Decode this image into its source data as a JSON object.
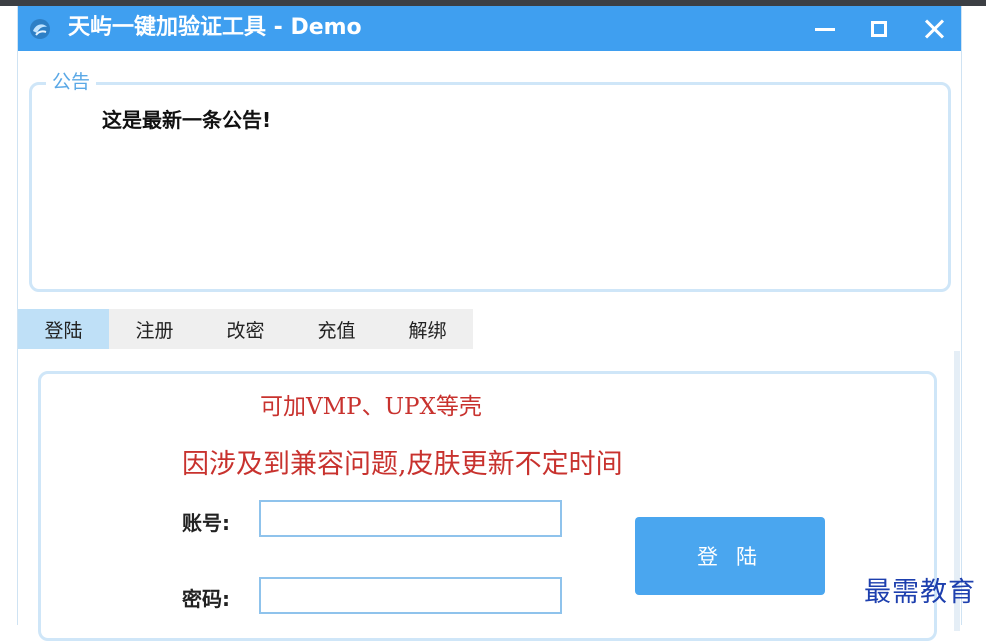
{
  "window": {
    "title": "天屿一键加验证工具 - Demo",
    "accent_color": "#3f9ff0",
    "icon": "app-logo-icon",
    "controls": [
      "minimize-icon",
      "maximize-icon",
      "close-icon"
    ]
  },
  "notice": {
    "legend": "公告",
    "content": "这是最新一条公告!"
  },
  "tabs": [
    {
      "label": "登陆",
      "active": true
    },
    {
      "label": "注册",
      "active": false
    },
    {
      "label": "改密",
      "active": false
    },
    {
      "label": "充值",
      "active": false
    },
    {
      "label": "解绑",
      "active": false
    }
  ],
  "login_panel": {
    "info_line1": "可加VMP、UPX等壳",
    "info_line2": "因涉及到兼容问题,皮肤更新不定时间",
    "info_color": "#c8322e",
    "account_label": "账号:",
    "account_value": "",
    "password_label": "密码:",
    "password_value": "",
    "login_button": "登陆"
  },
  "watermark": "最需教育"
}
